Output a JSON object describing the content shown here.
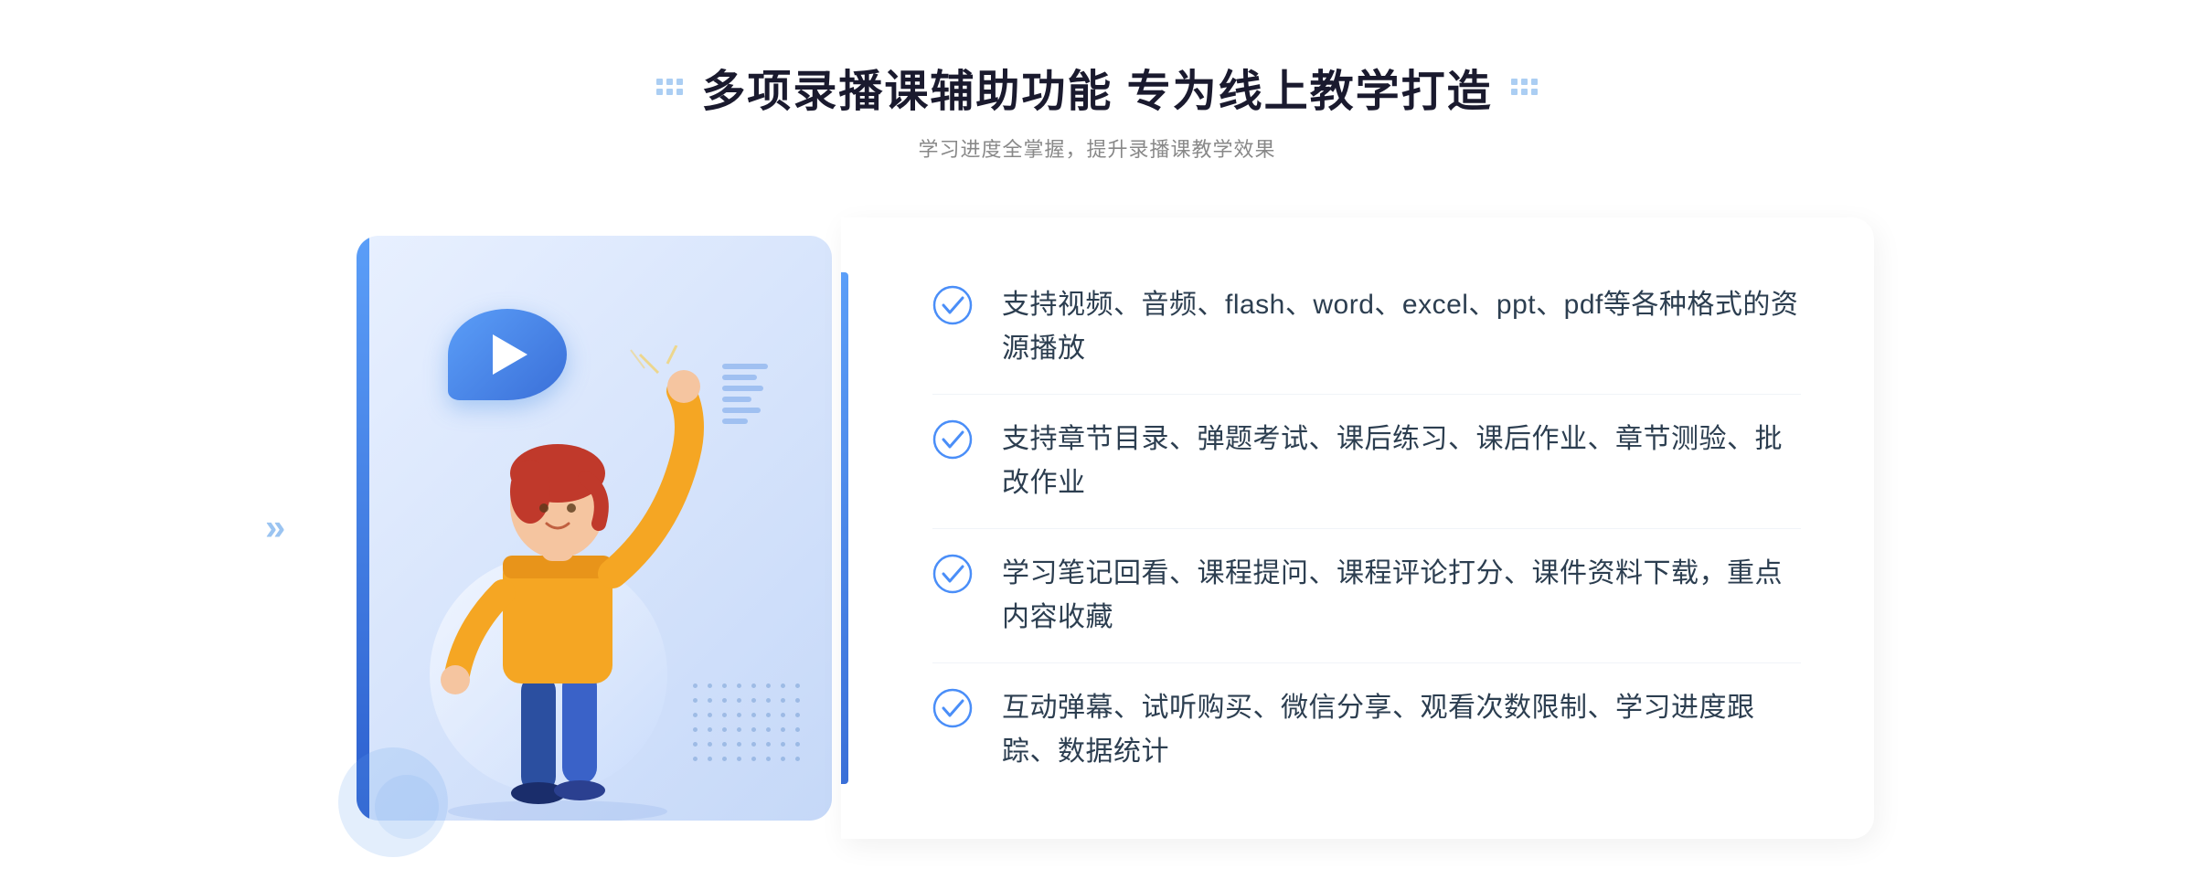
{
  "header": {
    "title": "多项录播课辅助功能 专为线上教学打造",
    "subtitle": "学习进度全掌握，提升录播课教学效果"
  },
  "features": [
    {
      "id": "feature-1",
      "text": "支持视频、音频、flash、word、excel、ppt、pdf等各种格式的资源播放"
    },
    {
      "id": "feature-2",
      "text": "支持章节目录、弹题考试、课后练习、课后作业、章节测验、批改作业"
    },
    {
      "id": "feature-3",
      "text": "学习笔记回看、课程提问、课程评论打分、课件资料下载，重点内容收藏"
    },
    {
      "id": "feature-4",
      "text": "互动弹幕、试听购买、微信分享、观看次数限制、学习进度跟踪、数据统计"
    }
  ],
  "colors": {
    "primary_blue": "#4a8ef8",
    "dark_blue": "#2c5fce",
    "text_dark": "#2c3e50",
    "text_gray": "#888888",
    "bg_light": "#eef3fc"
  },
  "icons": {
    "check_circle": "check-circle-icon",
    "play": "play-icon",
    "chevron": "chevron-right-icon"
  }
}
